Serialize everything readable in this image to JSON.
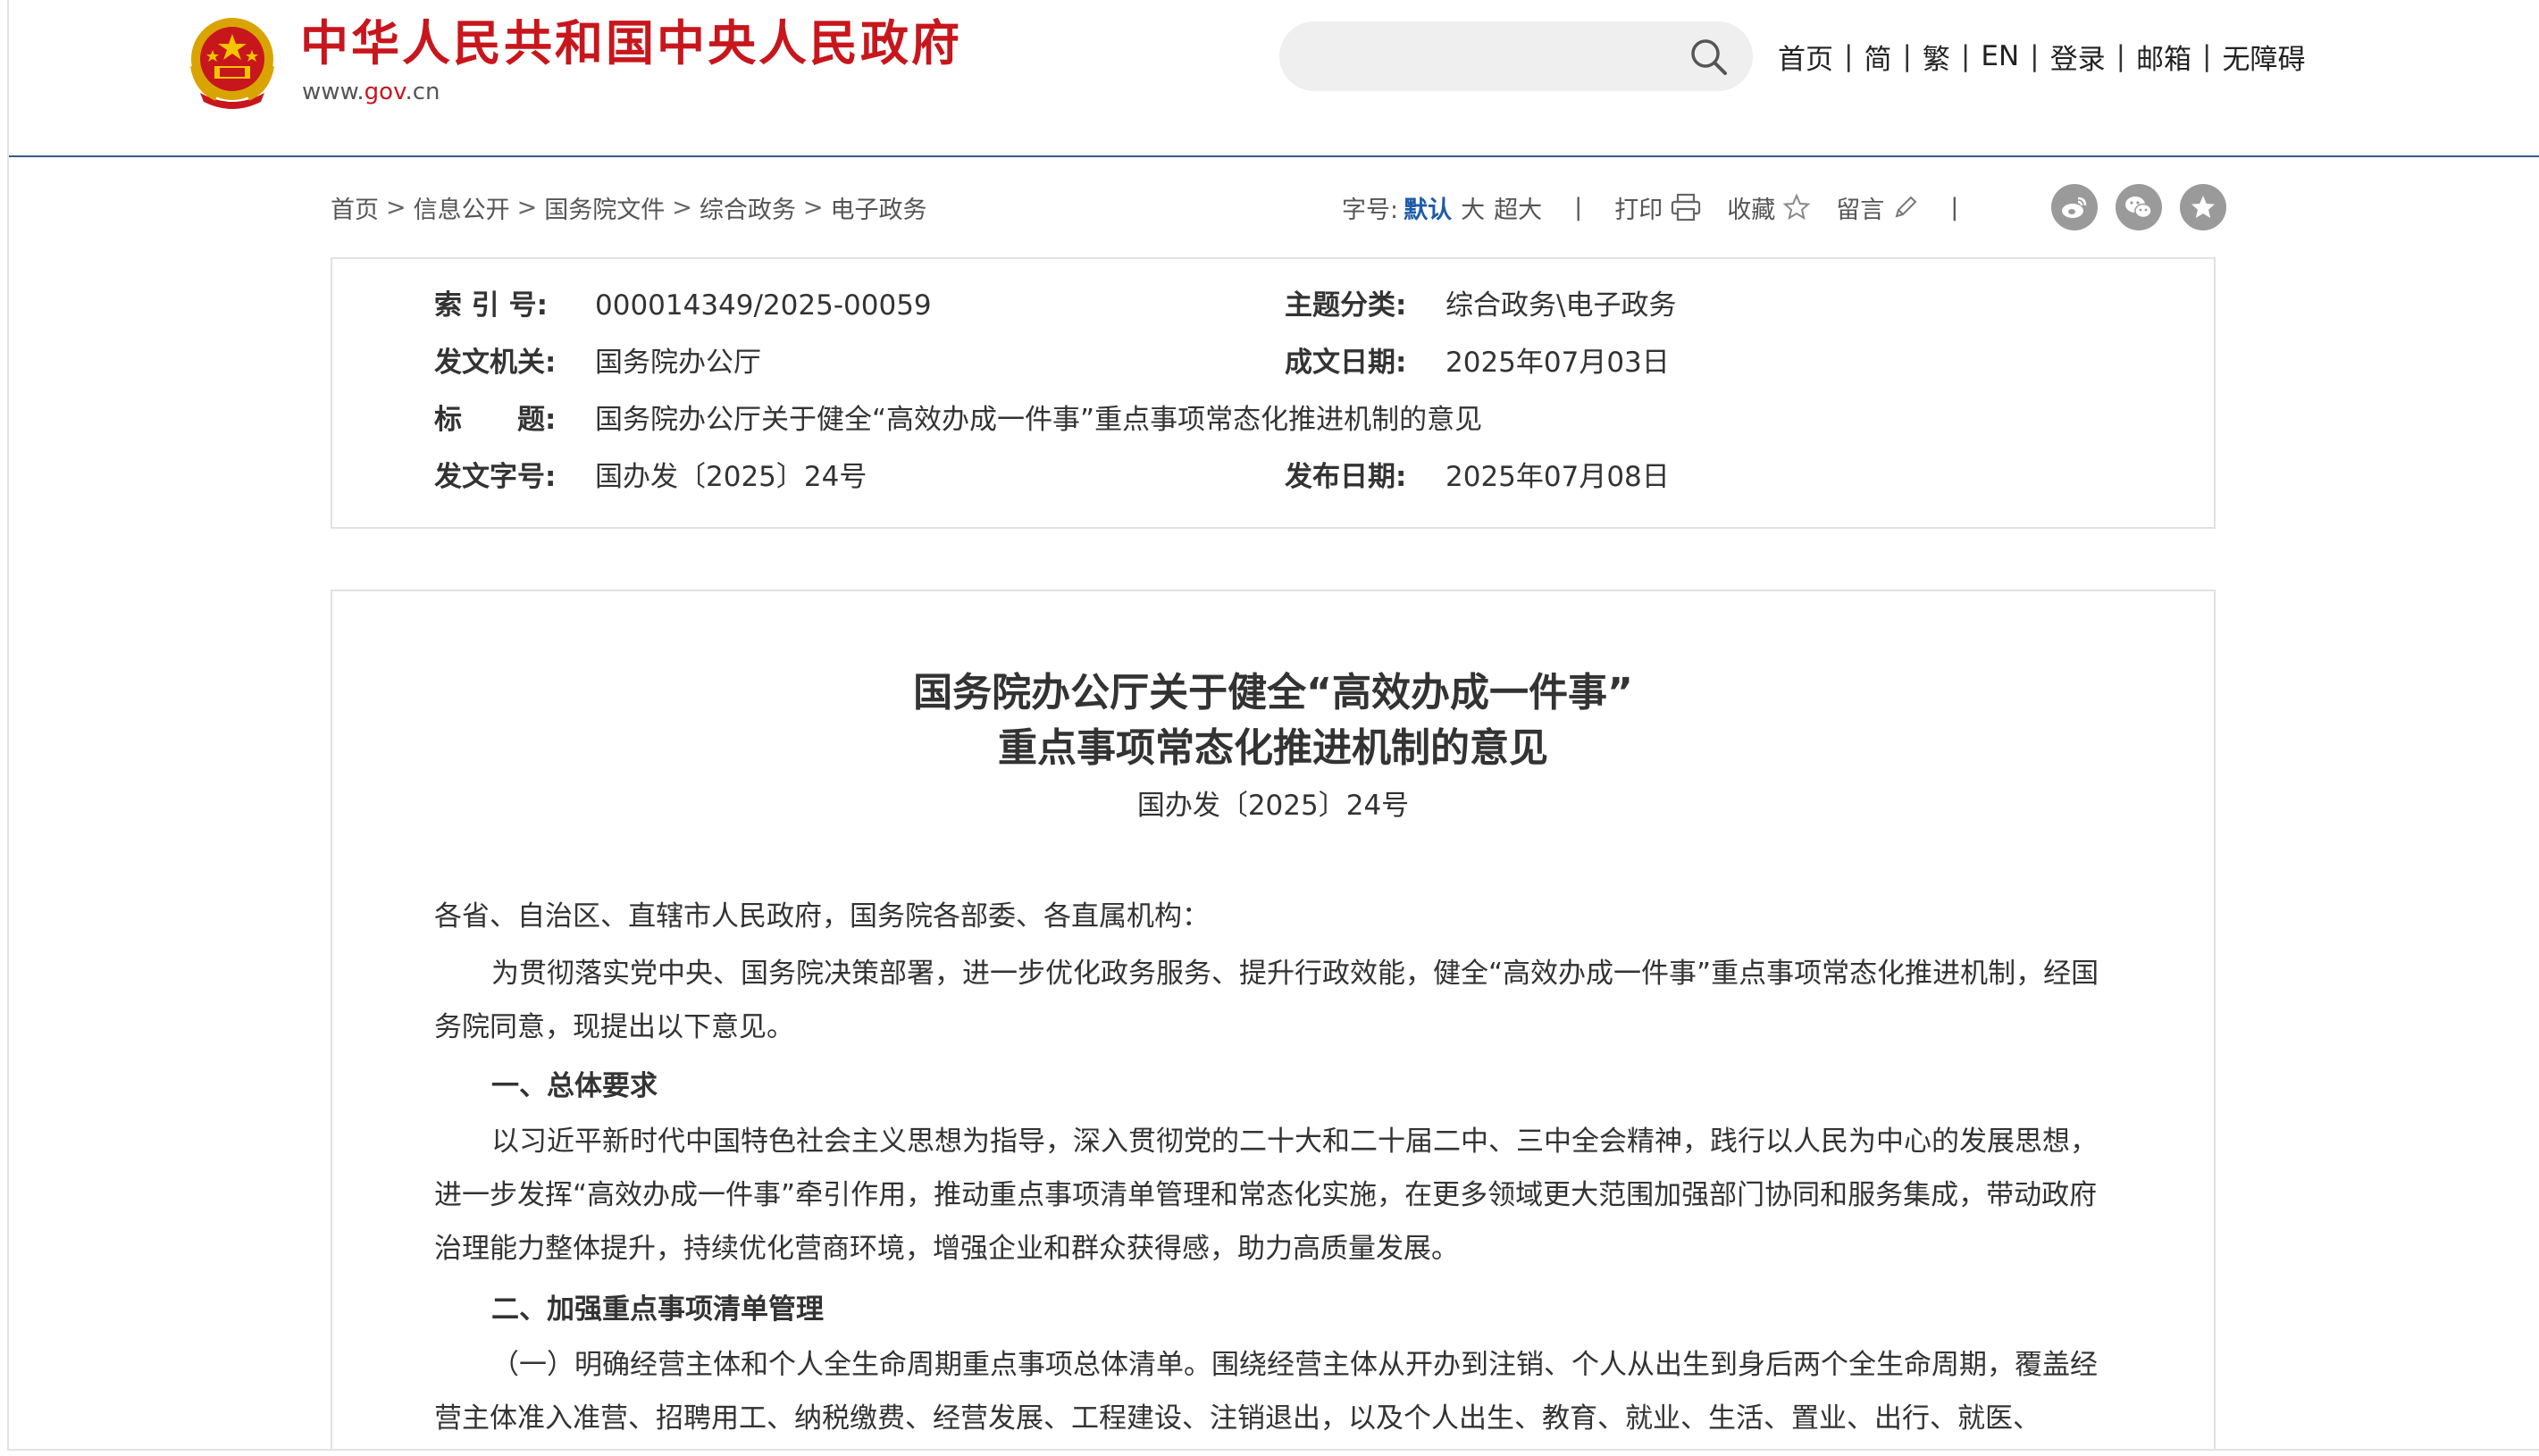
{
  "header": {
    "site_title": "中华人民共和国中央人民政府",
    "domain_prefix": "www.",
    "domain_gov": "gov",
    "domain_suffix": ".cn",
    "search_placeholder": "",
    "nav": [
      "首页",
      "简",
      "繁",
      "EN",
      "登录",
      "邮箱",
      "无障碍"
    ]
  },
  "breadcrumb": [
    "首页",
    "信息公开",
    "国务院文件",
    "综合政务",
    "电子政务"
  ],
  "toolbar": {
    "font_size_label": "字号:",
    "font_default": "默认",
    "font_large": "大",
    "font_xlarge": "超大",
    "print": "打印",
    "favorite": "收藏",
    "comment": "留言"
  },
  "share_icons": [
    "weibo-icon",
    "wechat-icon",
    "star-icon"
  ],
  "meta": {
    "index_label": "索 引 号:",
    "index_value": "000014349/2025-00059",
    "category_label": "主题分类:",
    "category_value": "综合政务\\电子政务",
    "issuer_label": "发文机关:",
    "issuer_value": "国务院办公厅",
    "written_label": "成文日期:",
    "written_value": "2025年07月03日",
    "title_label": "标　　题:",
    "title_value": "国务院办公厅关于健全“高效办成一件事”重点事项常态化推进机制的意见",
    "docno_label": "发文字号:",
    "docno_value": "国办发〔2025〕24号",
    "published_label": "发布日期:",
    "published_value": "2025年07月08日"
  },
  "article": {
    "title_line1": "国务院办公厅关于健全“高效办成一件事”",
    "title_line2": "重点事项常态化推进机制的意见",
    "doc_number": "国办发〔2025〕24号",
    "addressee": "各省、自治区、直辖市人民政府，国务院各部委、各直属机构：",
    "intro": "为贯彻落实党中央、国务院决策部署，进一步优化政务服务、提升行政效能，健全“高效办成一件事”重点事项常态化推进机制，经国务院同意，现提出以下意见。",
    "section1_heading": "一、总体要求",
    "section1_body": "以习近平新时代中国特色社会主义思想为指导，深入贯彻党的二十大和二十届二中、三中全会精神，践行以人民为中心的发展思想，进一步发挥“高效办成一件事”牵引作用，推动重点事项清单管理和常态化实施，在更多领域更大范围加强部门协同和服务集成，带动政府治理能力整体提升，持续优化营商环境，增强企业和群众获得感，助力高质量发展。",
    "section2_heading": "二、加强重点事项清单管理",
    "section2_body": "（一）明确经营主体和个人全生命周期重点事项总体清单。围绕经营主体从开办到注销、个人从出生到身后两个全生命周期，覆盖经营主体准入准营、招聘用工、纳税缴费、经营发展、工程建设、注销退出，以及个人出生、教育、就业、生活、置业、出行、就医、"
  },
  "colors": {
    "brand_red": "#c8161d",
    "header_rule": "#3c5a7e",
    "active_blue": "#1d5ba8",
    "border_gray": "#e2e2e2"
  }
}
